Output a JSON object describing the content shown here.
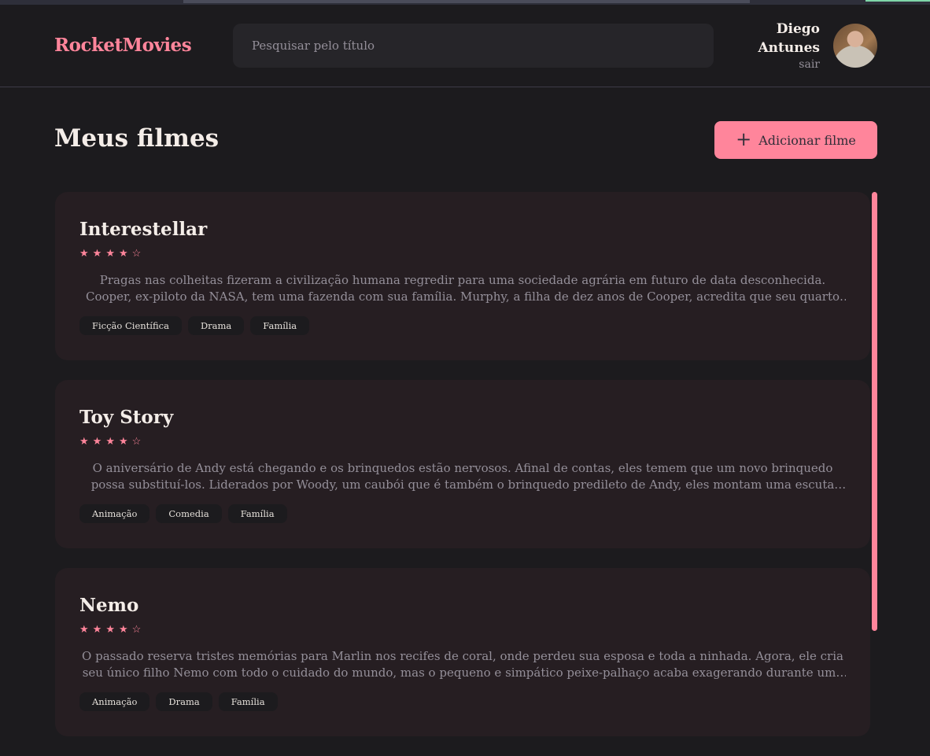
{
  "header": {
    "brand": "RocketMovies",
    "search_placeholder": "Pesquisar pelo título",
    "user_name": "Diego Antunes",
    "logout_label": "sair"
  },
  "page": {
    "title": "Meus filmes",
    "add_button_label": "Adicionar filme"
  },
  "colors": {
    "accent": "#ff859b",
    "background": "#1c1b1e",
    "card": "#261e22"
  },
  "movies": [
    {
      "title": "Interestellar",
      "rating": 4,
      "max_rating": 5,
      "description": "Pragas nas colheitas fizeram a civilização humana regredir para uma sociedade agrária em futuro de data desconhecida. Cooper, ex-piloto da NASA, tem uma fazenda com sua família. Murphy, a filha de dez anos de Cooper, acredita que seu quarto está assombrado por um fantasma que tenta se comunicar com ela.",
      "tags": [
        "Ficção Científica",
        "Drama",
        "Família"
      ]
    },
    {
      "title": "Toy Story",
      "rating": 4,
      "max_rating": 5,
      "description": "O aniversário de Andy está chegando e os brinquedos estão nervosos. Afinal de contas, eles temem que um novo brinquedo possa substituí-los. Liderados por Woody, um caubói que é também o brinquedo predileto de Andy, eles montam uma escuta que lhes permite saber dos presentes ganhos.",
      "tags": [
        "Animação",
        "Comedia",
        "Família"
      ]
    },
    {
      "title": "Nemo",
      "rating": 4,
      "max_rating": 5,
      "description": "O passado reserva tristes memórias para Marlin nos recifes de coral, onde perdeu sua esposa e toda a ninhada. Agora, ele cria seu único filho Nemo com todo o cuidado do mundo, mas o pequeno e simpático peixe-palhaço acaba exagerando durante uma excursão escolar.",
      "tags": [
        "Animação",
        "Drama",
        "Família"
      ]
    }
  ]
}
